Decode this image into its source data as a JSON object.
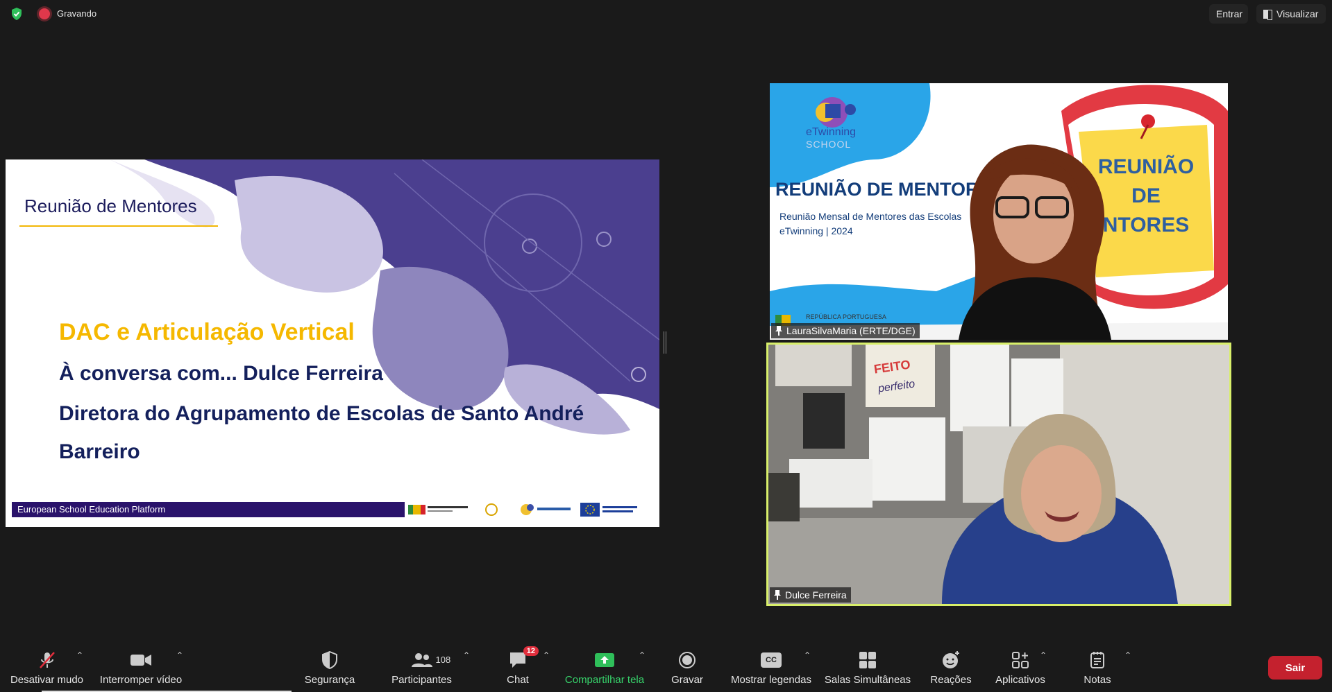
{
  "topbar": {
    "recording_label": "Gravando",
    "enter_label": "Entrar",
    "view_label": "Visualizar"
  },
  "slide": {
    "title": "Reunião de Mentores",
    "heading": "DAC e Articulação Vertical",
    "line1": "À conversa com... Dulce Ferreira",
    "line2": "Diretora do Agrupamento de Escolas de Santo André",
    "line3": "Barreiro",
    "footer": "European School Education Platform"
  },
  "tiles": [
    {
      "name": "LauraSilvaMaria (ERTE/DGE)",
      "banner_title": "REUNIÃO DE MENTORE",
      "banner_sub1": "Reunião Mensal de Mentores das Escolas",
      "banner_sub2": "eTwinning | 2024",
      "badge_line1": "REUNIÃO",
      "badge_line2": "DE",
      "badge_line3": "NTORES",
      "logo_label": "eTwinning",
      "logo_sub": "SCHOOL",
      "footer_text": "REPÚBLICA PORTUGUESA"
    },
    {
      "name": "Dulce Ferreira",
      "poster_text1": "FEITO",
      "poster_text2": "perfeito"
    }
  ],
  "toolbar": {
    "mute": "Desativar mudo",
    "video": "Interromper vídeo",
    "security": "Segurança",
    "participants": "Participantes",
    "participants_count": "108",
    "chat": "Chat",
    "chat_badge": "12",
    "share": "Compartilhar tela",
    "record": "Gravar",
    "captions": "Mostrar legendas",
    "captions_icon": "CC",
    "breakout": "Salas Simultâneas",
    "reactions": "Reações",
    "apps": "Aplicativos",
    "notes": "Notas",
    "leave": "Sair"
  },
  "colors": {
    "accent_green": "#37d36b",
    "leave_red": "#c4212e",
    "active_border": "#d8ef6a",
    "slide_purple": "#4b3f8f",
    "slide_navy": "#14205c",
    "slide_yellow": "#f5b800"
  }
}
